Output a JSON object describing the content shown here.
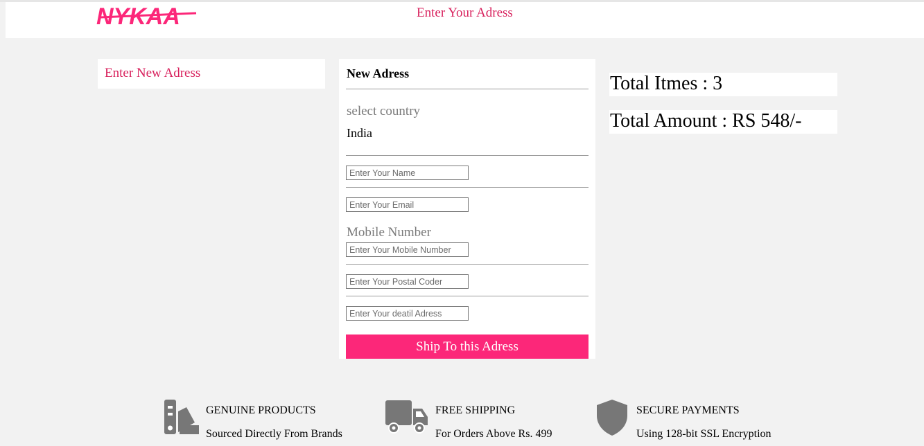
{
  "header": {
    "brand": "NYKAA",
    "title": "Enter Your Adress",
    "brand_color": "#fc2779"
  },
  "sidebar": {
    "new_address_label": "Enter New Adress"
  },
  "form": {
    "title": "New Adress",
    "country_label": "select country",
    "country_value": "India",
    "name_placeholder": "Enter Your Name",
    "email_placeholder": "Enter Your Email",
    "mobile_label": "Mobile Number",
    "mobile_placeholder": "Enter Your Mobile Number",
    "postal_placeholder": "Enter Your Postal Coder",
    "address_placeholder": "Enter Your deatil Adress",
    "submit_label": "Ship To this Adress",
    "submit_color": "#fc2779"
  },
  "summary": {
    "total_items": "Total Itmes : 3",
    "total_amount": "Total Amount : RS 548/-"
  },
  "features": [
    {
      "icon": "swatch-icon",
      "title": "GENUINE PRODUCTS",
      "subtitle": "Sourced Directly From Brands"
    },
    {
      "icon": "truck-icon",
      "title": "FREE SHIPPING",
      "subtitle": "For Orders Above Rs. 499"
    },
    {
      "icon": "shield-icon",
      "title": "SECURE PAYMENTS",
      "subtitle": "Using 128-bit SSL Encryption"
    }
  ]
}
